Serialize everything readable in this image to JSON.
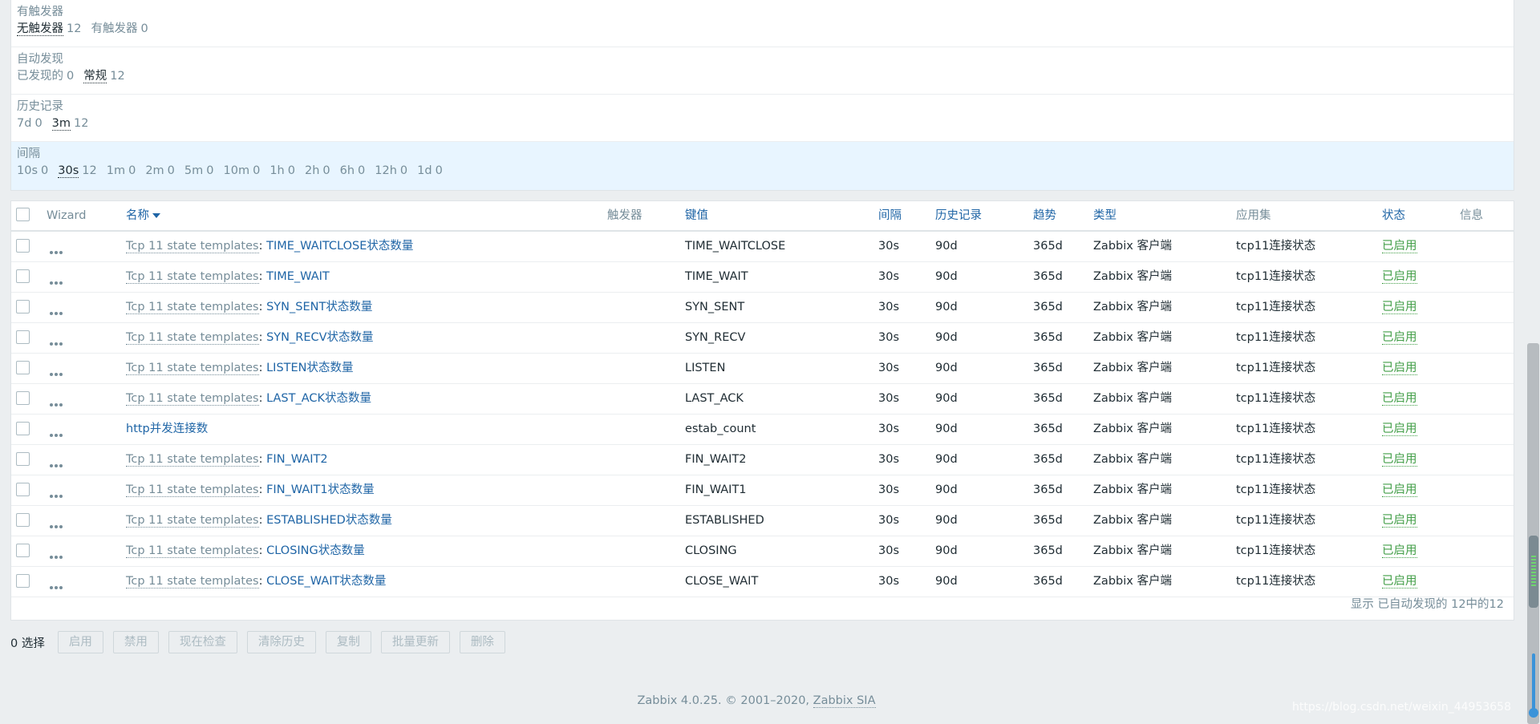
{
  "filters": [
    {
      "title": "有触发器",
      "values": [
        {
          "label": "无触发器",
          "count": "12",
          "selected": true
        },
        {
          "label": "有触发器",
          "count": "0",
          "selected": false
        }
      ]
    },
    {
      "title": "自动发现",
      "values": [
        {
          "label": "已发现的",
          "count": "0",
          "selected": false
        },
        {
          "label": "常规",
          "count": "12",
          "selected": true
        }
      ]
    },
    {
      "title": "历史记录",
      "values": [
        {
          "label": "7d",
          "count": "0",
          "selected": false
        },
        {
          "label": "3m",
          "count": "12",
          "selected": true
        }
      ]
    },
    {
      "title": "间隔",
      "values": [
        {
          "label": "10s",
          "count": "0",
          "selected": false
        },
        {
          "label": "30s",
          "count": "12",
          "selected": true
        },
        {
          "label": "1m",
          "count": "0",
          "selected": false
        },
        {
          "label": "2m",
          "count": "0",
          "selected": false
        },
        {
          "label": "5m",
          "count": "0",
          "selected": false
        },
        {
          "label": "10m",
          "count": "0",
          "selected": false
        },
        {
          "label": "1h",
          "count": "0",
          "selected": false
        },
        {
          "label": "2h",
          "count": "0",
          "selected": false
        },
        {
          "label": "6h",
          "count": "0",
          "selected": false
        },
        {
          "label": "12h",
          "count": "0",
          "selected": false
        },
        {
          "label": "1d",
          "count": "0",
          "selected": false
        }
      ]
    }
  ],
  "table": {
    "headers": {
      "wizard": "Wizard",
      "name": "名称",
      "triggers": "触发器",
      "key": "键值",
      "interval": "间隔",
      "history": "历史记录",
      "trends": "趋势",
      "type": "类型",
      "applications": "应用集",
      "status": "状态",
      "info": "信息"
    },
    "rows": [
      {
        "prefix": "Tcp 11 state templates",
        "name": "TIME_WAITCLOSE状态数量",
        "key": "TIME_WAITCLOSE",
        "interval": "30s",
        "history": "90d",
        "trends": "365d",
        "type": "Zabbix 客户端",
        "app": "tcp11连接状态",
        "status": "已启用"
      },
      {
        "prefix": "Tcp 11 state templates",
        "name": "TIME_WAIT",
        "key": "TIME_WAIT",
        "interval": "30s",
        "history": "90d",
        "trends": "365d",
        "type": "Zabbix 客户端",
        "app": "tcp11连接状态",
        "status": "已启用"
      },
      {
        "prefix": "Tcp 11 state templates",
        "name": "SYN_SENT状态数量",
        "key": "SYN_SENT",
        "interval": "30s",
        "history": "90d",
        "trends": "365d",
        "type": "Zabbix 客户端",
        "app": "tcp11连接状态",
        "status": "已启用"
      },
      {
        "prefix": "Tcp 11 state templates",
        "name": "SYN_RECV状态数量",
        "key": "SYN_RECV",
        "interval": "30s",
        "history": "90d",
        "trends": "365d",
        "type": "Zabbix 客户端",
        "app": "tcp11连接状态",
        "status": "已启用"
      },
      {
        "prefix": "Tcp 11 state templates",
        "name": "LISTEN状态数量",
        "key": "LISTEN",
        "interval": "30s",
        "history": "90d",
        "trends": "365d",
        "type": "Zabbix 客户端",
        "app": "tcp11连接状态",
        "status": "已启用"
      },
      {
        "prefix": "Tcp 11 state templates",
        "name": "LAST_ACK状态数量",
        "key": "LAST_ACK",
        "interval": "30s",
        "history": "90d",
        "trends": "365d",
        "type": "Zabbix 客户端",
        "app": "tcp11连接状态",
        "status": "已启用"
      },
      {
        "prefix": "",
        "name": "http并发连接数",
        "key": "estab_count",
        "interval": "30s",
        "history": "90d",
        "trends": "365d",
        "type": "Zabbix 客户端",
        "app": "tcp11连接状态",
        "status": "已启用"
      },
      {
        "prefix": "Tcp 11 state templates",
        "name": "FIN_WAIT2",
        "key": "FIN_WAIT2",
        "interval": "30s",
        "history": "90d",
        "trends": "365d",
        "type": "Zabbix 客户端",
        "app": "tcp11连接状态",
        "status": "已启用"
      },
      {
        "prefix": "Tcp 11 state templates",
        "name": "FIN_WAIT1状态数量",
        "key": "FIN_WAIT1",
        "interval": "30s",
        "history": "90d",
        "trends": "365d",
        "type": "Zabbix 客户端",
        "app": "tcp11连接状态",
        "status": "已启用"
      },
      {
        "prefix": "Tcp 11 state templates",
        "name": "ESTABLISHED状态数量",
        "key": "ESTABLISHED",
        "interval": "30s",
        "history": "90d",
        "trends": "365d",
        "type": "Zabbix 客户端",
        "app": "tcp11连接状态",
        "status": "已启用"
      },
      {
        "prefix": "Tcp 11 state templates",
        "name": "CLOSING状态数量",
        "key": "CLOSING",
        "interval": "30s",
        "history": "90d",
        "trends": "365d",
        "type": "Zabbix 客户端",
        "app": "tcp11连接状态",
        "status": "已启用"
      },
      {
        "prefix": "Tcp 11 state templates",
        "name": "CLOSE_WAIT状态数量",
        "key": "CLOSE_WAIT",
        "interval": "30s",
        "history": "90d",
        "trends": "365d",
        "type": "Zabbix 客户端",
        "app": "tcp11连接状态",
        "status": "已启用"
      }
    ],
    "footer_text": "显示 已自动发现的 12中的12"
  },
  "actions": {
    "selected_count": "0 选择",
    "buttons": [
      "启用",
      "禁用",
      "现在检查",
      "清除历史",
      "复制",
      "批量更新",
      "删除"
    ]
  },
  "footer": {
    "text": "Zabbix 4.0.25. © 2001–2020,",
    "link": "Zabbix SIA"
  },
  "watermark": "https://blog.csdn.net/weixin_44953658",
  "colors": {
    "link": "#1f65a6",
    "status_enabled": "#429e47",
    "muted": "#768d99",
    "active_filter_bg": "#e8f5ff"
  }
}
